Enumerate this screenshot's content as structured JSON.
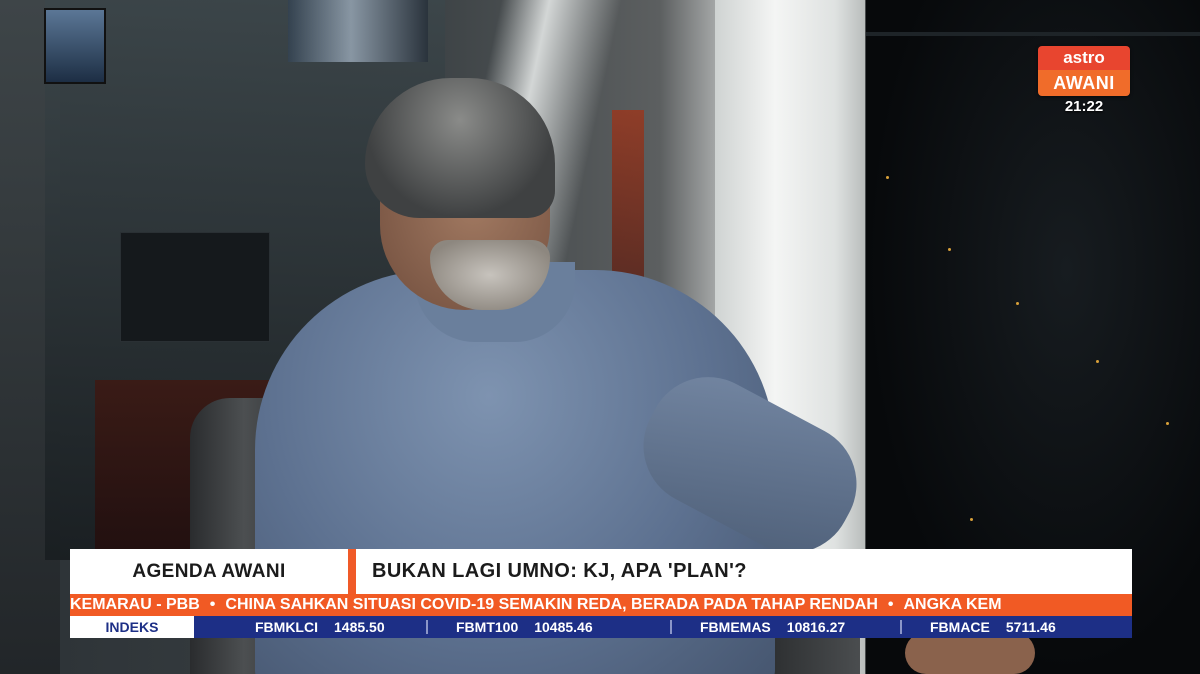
{
  "channel": {
    "logo_top": "astro",
    "logo_bottom": "AWANI",
    "clock": "21:22"
  },
  "lower_third": {
    "program": "AGENDA AWANI",
    "headline": "BUKAN LAGI UMNO: KJ, APA 'PLAN'?"
  },
  "ticker": {
    "items": [
      "KEMARAU - PBB",
      "CHINA SAHKAN SITUASI COVID-19 SEMAKIN REDA, BERADA PADA TAHAP RENDAH",
      "ANGKA KEM"
    ],
    "separator": "•"
  },
  "market": {
    "label": "INDEKS",
    "indices": [
      {
        "name": "FBMKLCI",
        "value": "1485.50"
      },
      {
        "name": "FBMT100",
        "value": "10485.46"
      },
      {
        "name": "FBMEMAS",
        "value": "10816.27"
      },
      {
        "name": "FBMACE",
        "value": "5711.46"
      }
    ]
  },
  "colors": {
    "accent_orange": "#f15a24",
    "market_blue": "#1d2f86",
    "logo_red": "#e8452f"
  }
}
